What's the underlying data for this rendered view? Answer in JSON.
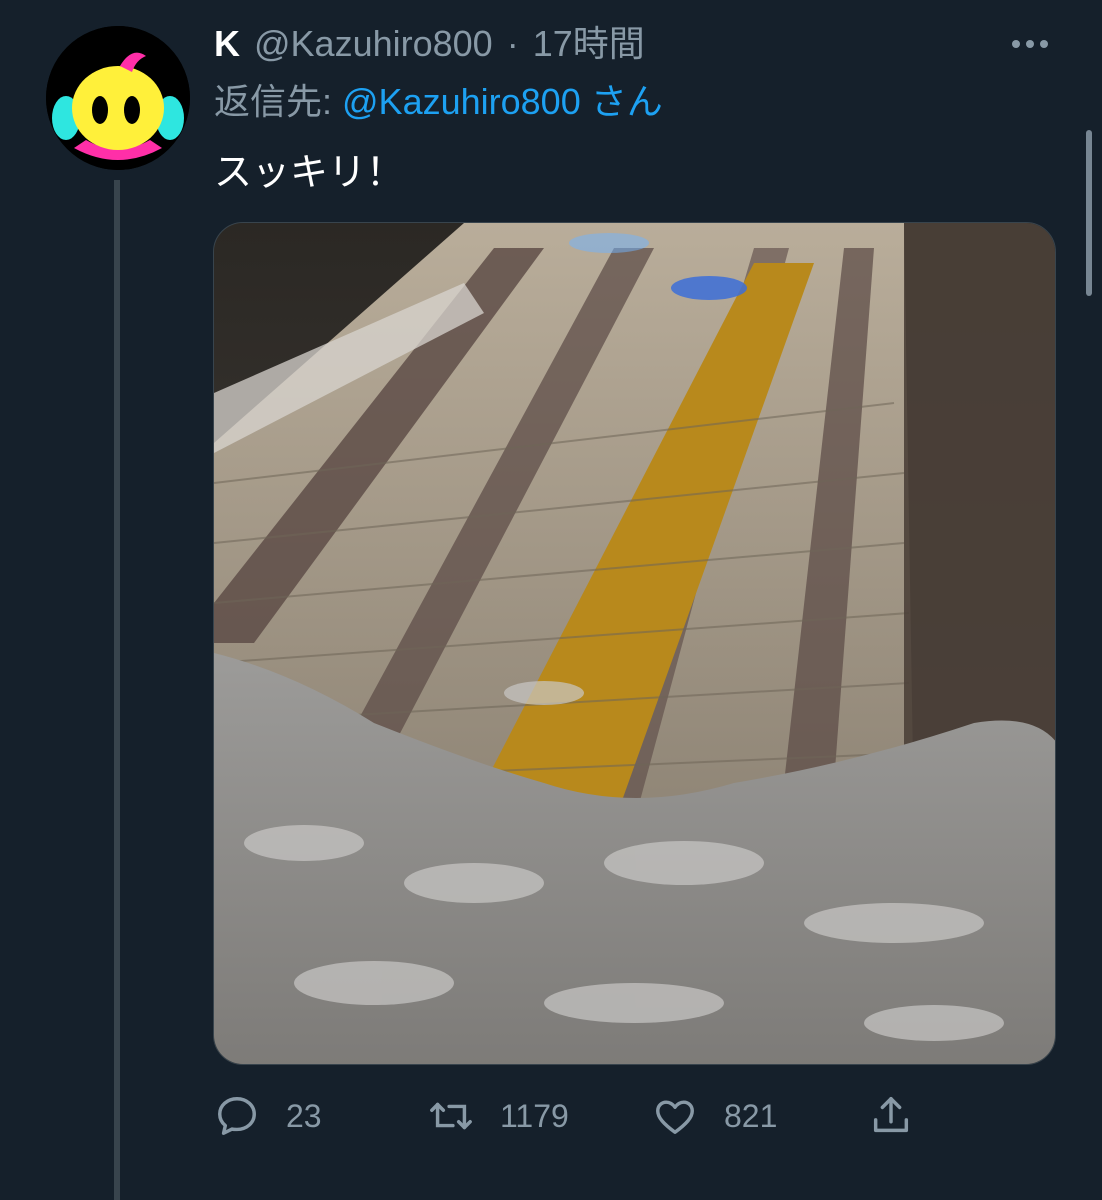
{
  "tweet": {
    "display_name": "K",
    "handle": "@Kazuhiro800",
    "separator": "·",
    "time": "17時間",
    "reply_label": "返信先: ",
    "reply_user": "@Kazuhiro800 さん",
    "text": "スッキリ！",
    "avatar_icon": "yellow-blob-character-avatar",
    "media_description_icon": "snowy-tiled-sidewalk-photo"
  },
  "actions": {
    "reply_count": "23",
    "retweet_count": "1179",
    "like_count": "821"
  },
  "colors": {
    "background": "#15202b",
    "secondary_text": "#8899a6",
    "link": "#1da1f2",
    "divider": "#38444d"
  }
}
